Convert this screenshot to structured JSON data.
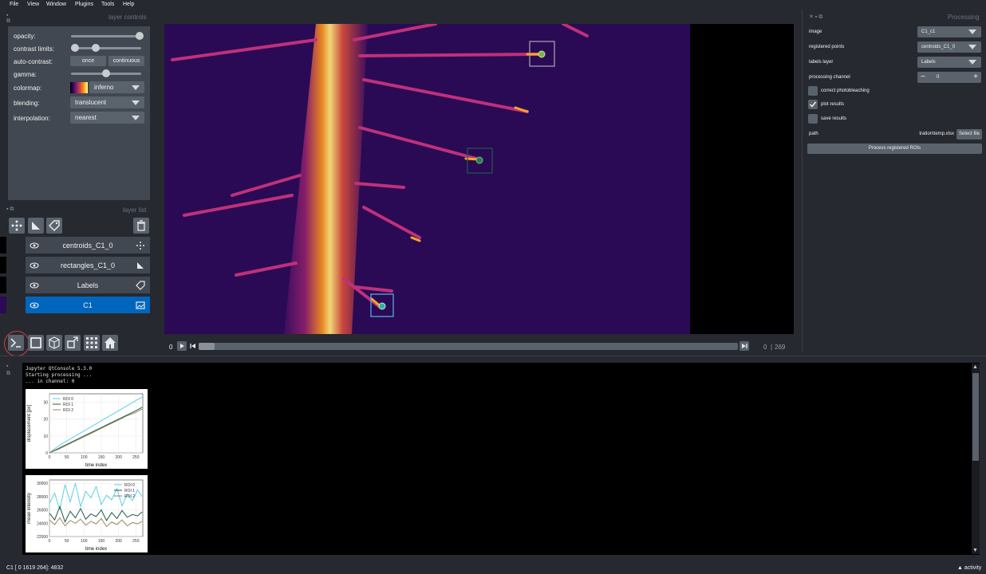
{
  "menu": [
    "File",
    "View",
    "Window",
    "Plugins",
    "Tools",
    "Help"
  ],
  "layer_controls": {
    "title": "layer controls",
    "opacity_label": "opacity:",
    "opacity": 1.0,
    "contrast_label": "contrast limits:",
    "auto_contrast_label": "auto-contrast:",
    "once_label": "once",
    "continuous_label": "continuous",
    "gamma_label": "gamma:",
    "gamma": 0.5,
    "colormap_label": "colormap:",
    "colormap": "inferno",
    "blending_label": "blending:",
    "blending": "translucent",
    "interpolation_label": "interpolation:",
    "interpolation": "nearest"
  },
  "layer_list": {
    "title": "layer list",
    "layers": [
      {
        "name": "centroids_C1_0",
        "icon": "points-icon",
        "selected": false
      },
      {
        "name": "rectangles_C1_0",
        "icon": "shapes-icon",
        "selected": false
      },
      {
        "name": "Labels",
        "icon": "labels-icon",
        "selected": false
      },
      {
        "name": "C1",
        "icon": "image-icon",
        "selected": true
      }
    ]
  },
  "viewer": {
    "frame_start": "0",
    "frame_current": "0",
    "frame_total": "269"
  },
  "processing": {
    "title": "Processing",
    "image_label": "image",
    "image_value": "C1_c1",
    "points_label": "registered points",
    "points_value": "centroids_C1_0",
    "labels_label": "labels layer",
    "labels_value": "Labels",
    "channel_label": "processing channel",
    "channel_value": "0",
    "photobleaching_label": "correct photobleaching",
    "photobleaching_checked": false,
    "plot_label": "plot results",
    "plot_checked": true,
    "save_label": "save results",
    "save_checked": false,
    "path_label": "path",
    "path_value": "tration\\temp.xlsx",
    "select_file_label": "Select file",
    "process_button_label": "Process registered ROIs"
  },
  "console": {
    "lines": [
      "Jupyter QtConsole 5.3.0",
      "Starting processing ...",
      "... in channel: 0"
    ]
  },
  "status": {
    "left": "C1 [  0 1619  264]: 4832",
    "activity": "activity"
  },
  "chart_data": [
    {
      "type": "line",
      "title": "",
      "xlabel": "time index",
      "ylabel": "displacement [px]",
      "xlim": [
        0,
        270
      ],
      "ylim": [
        0,
        35
      ],
      "xticks": [
        0,
        50,
        100,
        150,
        200,
        250
      ],
      "yticks": [
        0,
        10,
        20,
        30
      ],
      "series": [
        {
          "name": "ROI 0",
          "color": "#5bd1e8",
          "x": [
            0,
            25,
            50,
            75,
            100,
            125,
            150,
            175,
            200,
            225,
            250,
            268
          ],
          "values": [
            0,
            4,
            7,
            10,
            13,
            16,
            19,
            22,
            25,
            28,
            31,
            33
          ]
        },
        {
          "name": "ROI 1",
          "color": "#1f5a4c",
          "x": [
            0,
            25,
            50,
            75,
            100,
            125,
            150,
            175,
            200,
            225,
            250,
            268
          ],
          "values": [
            0,
            2.5,
            5,
            7.5,
            10,
            12.5,
            15,
            17.5,
            20,
            22.5,
            25,
            27
          ]
        },
        {
          "name": "ROI 2",
          "color": "#9c8a60",
          "x": [
            0,
            25,
            50,
            75,
            100,
            125,
            150,
            175,
            200,
            225,
            250,
            268
          ],
          "values": [
            0,
            2,
            4.5,
            7,
            9.5,
            12,
            14.5,
            17,
            19.5,
            22,
            24,
            26
          ]
        }
      ]
    },
    {
      "type": "line",
      "title": "",
      "xlabel": "time index",
      "ylabel": "mean intensity",
      "xlim": [
        0,
        270
      ],
      "ylim": [
        22000,
        30500
      ],
      "xticks": [
        0,
        50,
        100,
        150,
        200,
        250
      ],
      "yticks": [
        22000,
        24000,
        26000,
        28000,
        30000
      ],
      "series": [
        {
          "name": "ROI 0",
          "color": "#5bd1e8",
          "x": [
            0,
            15,
            30,
            45,
            60,
            75,
            90,
            105,
            120,
            135,
            150,
            165,
            180,
            195,
            210,
            225,
            240,
            255,
            268
          ],
          "values": [
            27000,
            28500,
            26000,
            29800,
            27200,
            30000,
            26500,
            28800,
            27800,
            29500,
            26800,
            28200,
            27500,
            29200,
            26600,
            28400,
            27400,
            29000,
            28000
          ]
        },
        {
          "name": "ROI 1",
          "color": "#1f5a4c",
          "x": [
            0,
            15,
            30,
            45,
            60,
            75,
            90,
            105,
            120,
            135,
            150,
            165,
            180,
            195,
            210,
            225,
            240,
            255,
            268
          ],
          "values": [
            25500,
            24500,
            26500,
            24200,
            25800,
            24800,
            26200,
            24600,
            25400,
            25000,
            26000,
            24400,
            25600,
            24700,
            25900,
            24900,
            25300,
            25100,
            25700
          ]
        },
        {
          "name": "ROI 2",
          "color": "#9c8a60",
          "x": [
            0,
            15,
            30,
            45,
            60,
            75,
            90,
            105,
            120,
            135,
            150,
            165,
            180,
            195,
            210,
            225,
            240,
            255,
            268
          ],
          "values": [
            24500,
            23800,
            24800,
            23600,
            24400,
            24000,
            24600,
            23700,
            24300,
            23900,
            24700,
            23500,
            24200,
            23800,
            24500,
            23600,
            24100,
            23900,
            24300
          ]
        }
      ]
    }
  ]
}
